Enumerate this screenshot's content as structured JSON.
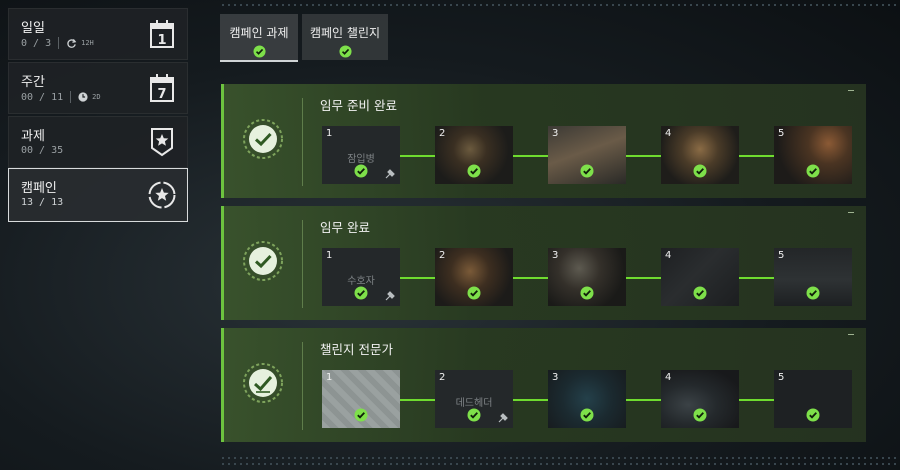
{
  "sidebar": {
    "items": [
      {
        "title": "일일",
        "progress": "0 / 3",
        "timer": "12H",
        "icon": "calendar-1-icon",
        "icon_text": "1"
      },
      {
        "title": "주간",
        "progress": "00 / 11",
        "timer": "2D",
        "icon": "calendar-7-icon",
        "icon_text": "7"
      },
      {
        "title": "과제",
        "progress": "00 / 35",
        "icon": "star-shield-icon"
      },
      {
        "title": "캠페인",
        "progress": "13 / 13",
        "icon": "star-circle-icon",
        "active": true
      }
    ]
  },
  "tabs": [
    {
      "label": "캠페인 과제",
      "active": true
    },
    {
      "label": "캠페인 챌린지",
      "active": false
    }
  ],
  "panels": [
    {
      "title": "임무 준비 완료",
      "tiles": [
        {
          "num": "1",
          "label": "잠입병",
          "tool": true
        },
        {
          "num": "2"
        },
        {
          "num": "3"
        },
        {
          "num": "4"
        },
        {
          "num": "5"
        }
      ]
    },
    {
      "title": "임무 완료",
      "tiles": [
        {
          "num": "1",
          "label": "수호자",
          "tool": true
        },
        {
          "num": "2"
        },
        {
          "num": "3"
        },
        {
          "num": "4"
        },
        {
          "num": "5"
        }
      ]
    },
    {
      "title": "챌린지 전문가",
      "tiles": [
        {
          "num": "1"
        },
        {
          "num": "2",
          "label": "데드헤더",
          "tool": true
        },
        {
          "num": "3"
        },
        {
          "num": "4"
        },
        {
          "num": "5"
        }
      ]
    }
  ],
  "colors": {
    "accent_green": "#6dc33f",
    "check_green": "#7ee04a"
  }
}
